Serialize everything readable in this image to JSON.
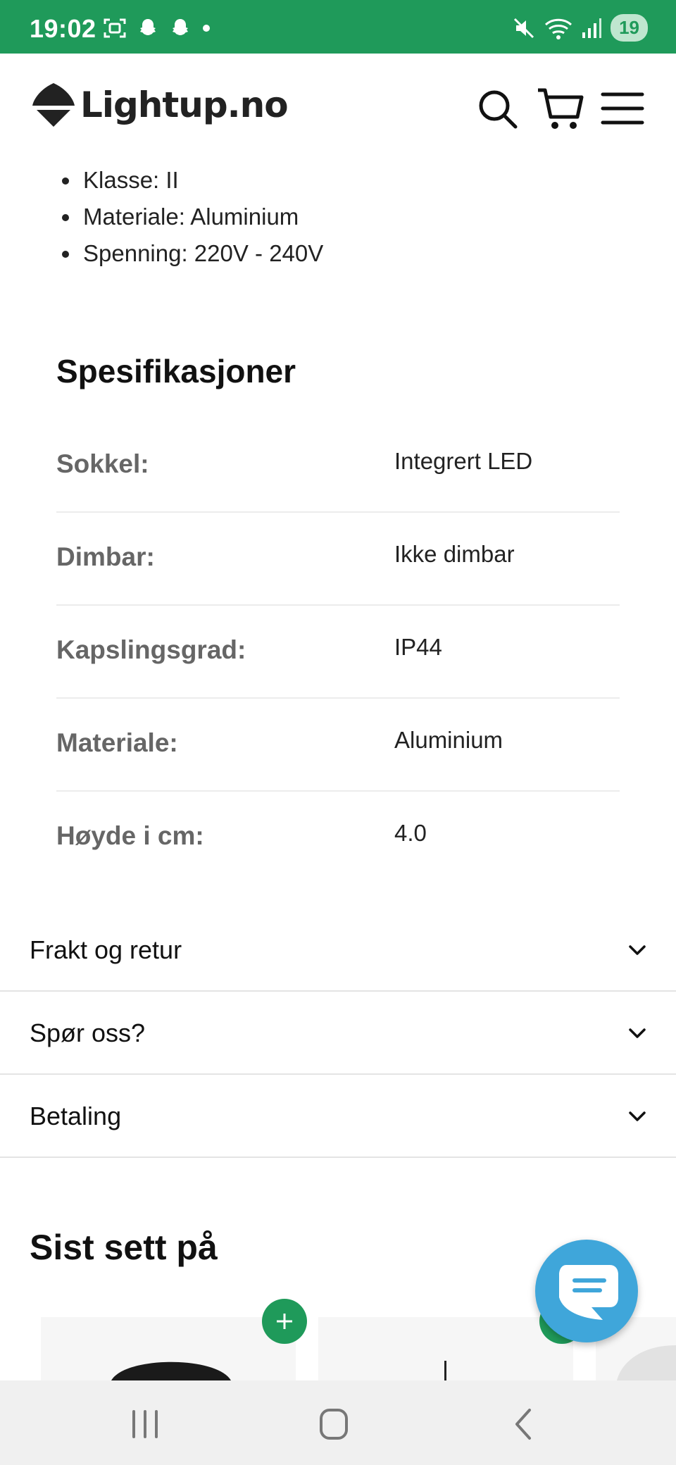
{
  "status_bar": {
    "time": "19:02",
    "battery": "19",
    "left_icons": [
      "screenshot-icon",
      "snapchat-icon",
      "snapchat-icon",
      "dot-icon"
    ],
    "right_icons": [
      "mute-icon",
      "wifi-icon",
      "signal-icon"
    ],
    "color": "#1f9a5a"
  },
  "header": {
    "logo_text": "Lightup.no",
    "icons": [
      "search-icon",
      "cart-icon",
      "menu-icon"
    ]
  },
  "bullets": [
    "Klasse: II",
    "Materiale: Aluminium",
    "Spenning: 220V - 240V"
  ],
  "specs": {
    "title": "Spesifikasjoner",
    "rows": [
      {
        "label": "Sokkel:",
        "value": "Integrert LED"
      },
      {
        "label": "Dimbar:",
        "value": "Ikke dimbar"
      },
      {
        "label": "Kapslingsgrad:",
        "value": "IP44"
      },
      {
        "label": "Materiale:",
        "value": "Aluminium"
      },
      {
        "label": "Høyde i cm:",
        "value": "4.0"
      }
    ]
  },
  "accordion": [
    {
      "label": "Frakt og retur"
    },
    {
      "label": "Spør oss?"
    },
    {
      "label": "Betaling"
    }
  ],
  "recently_viewed": {
    "title": "Sist sett på"
  },
  "colors": {
    "accent": "#1f9a5a",
    "chat": "#3fa6da"
  }
}
